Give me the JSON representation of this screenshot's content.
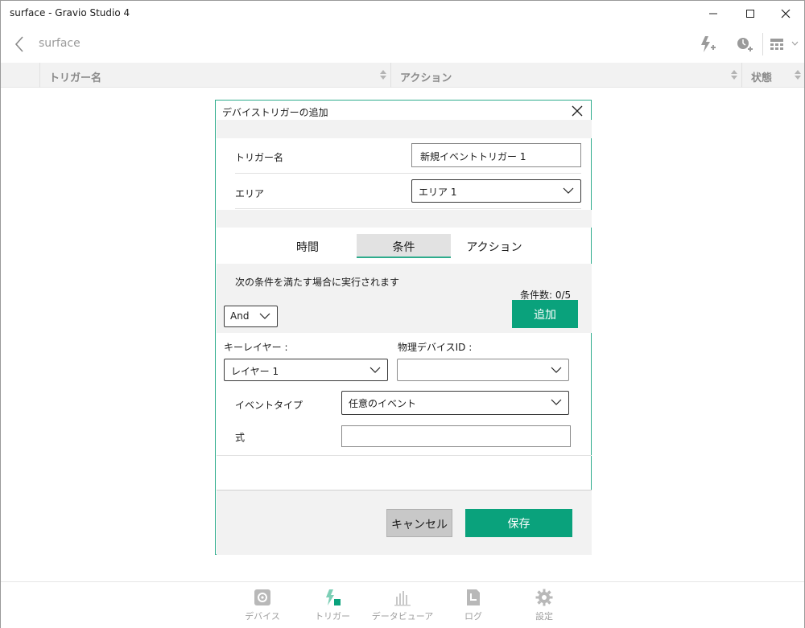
{
  "window": {
    "title": "surface - Gravio Studio 4"
  },
  "appbar": {
    "title": "surface",
    "icons": [
      "add-trigger-icon",
      "add-timer-icon",
      "view-toggle-icon"
    ]
  },
  "table": {
    "columns": [
      "トリガー名",
      "アクション",
      "状態"
    ]
  },
  "dialog": {
    "title": "デバイストリガーの追加",
    "trigger_name_label": "トリガー名",
    "trigger_name_value": "新規イベントトリガー 1",
    "area_label": "エリア",
    "area_value": "エリア 1",
    "tabs": [
      "時間",
      "条件",
      "アクション"
    ],
    "active_tab": "条件",
    "condition_desc": "次の条件を満たす場合に実行されます",
    "condition_count": "条件数: 0/5",
    "logic_value": "And",
    "add_button": "追加",
    "key_layer_label": "キーレイヤー :",
    "key_layer_value": "レイヤー 1",
    "device_id_label": "物理デバイスID :",
    "device_id_value": "",
    "event_type_label": "イベントタイプ",
    "event_type_value": "任意のイベント",
    "expression_label": "式",
    "expression_value": "",
    "cancel_button": "キャンセル",
    "save_button": "保存"
  },
  "bottom_nav": {
    "items": [
      {
        "label": "デバイス",
        "icon": "device-icon"
      },
      {
        "label": "トリガー",
        "icon": "trigger-icon"
      },
      {
        "label": "データビューア",
        "icon": "data-viewer-icon"
      },
      {
        "label": "ログ",
        "icon": "log-icon"
      },
      {
        "label": "設定",
        "icon": "settings-icon"
      }
    ],
    "active": "トリガー"
  },
  "colors": {
    "accent": "#0aa27c",
    "dialog_border": "#2eac8c",
    "band": "#f2f2f2"
  }
}
